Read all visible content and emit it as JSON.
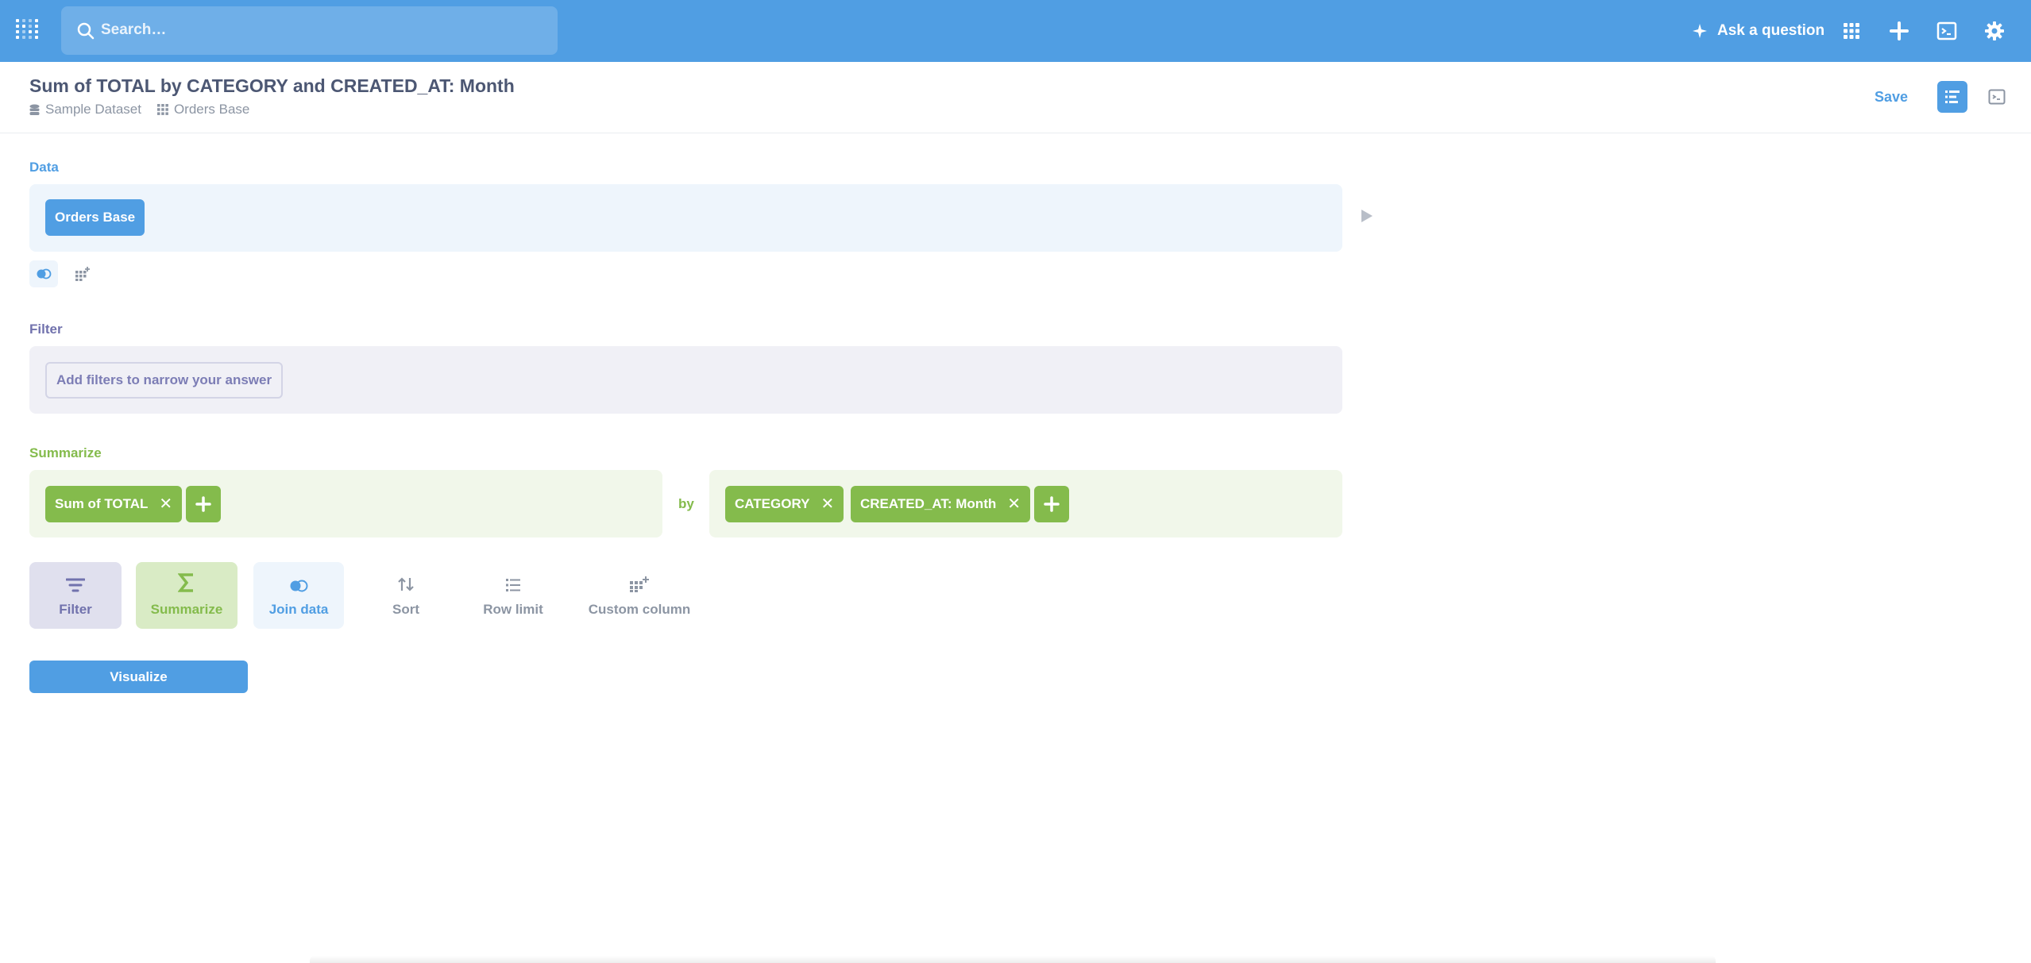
{
  "navbar": {
    "search_placeholder": "Search…",
    "ask_label": "Ask a question",
    "icons": [
      "metabase-logo-icon",
      "search-icon",
      "sparkle-icon",
      "apps-grid-icon",
      "plus-icon",
      "terminal-icon",
      "gear-icon"
    ]
  },
  "header": {
    "title": "Sum of TOTAL by CATEGORY and CREATED_AT: Month",
    "breadcrumbs": [
      "Sample Dataset",
      "Orders Base"
    ],
    "save_label": "Save"
  },
  "data_step": {
    "label": "Data",
    "source": "Orders Base"
  },
  "filter_step": {
    "label": "Filter",
    "placeholder": "Add filters to narrow your answer"
  },
  "summarize_step": {
    "label": "Summarize",
    "metrics": [
      "Sum of TOTAL"
    ],
    "by_label": "by",
    "breakouts": [
      "CATEGORY",
      "CREATED_AT: Month"
    ]
  },
  "actions": {
    "filter": "Filter",
    "summarize": "Summarize",
    "join": "Join data",
    "sort": "Sort",
    "row_limit": "Row limit",
    "custom_column": "Custom column"
  },
  "visualize_label": "Visualize",
  "colors": {
    "brand": "#509ee3",
    "summarize": "#84bb4c",
    "filter": "#7172ad",
    "text": "#4c5773"
  }
}
